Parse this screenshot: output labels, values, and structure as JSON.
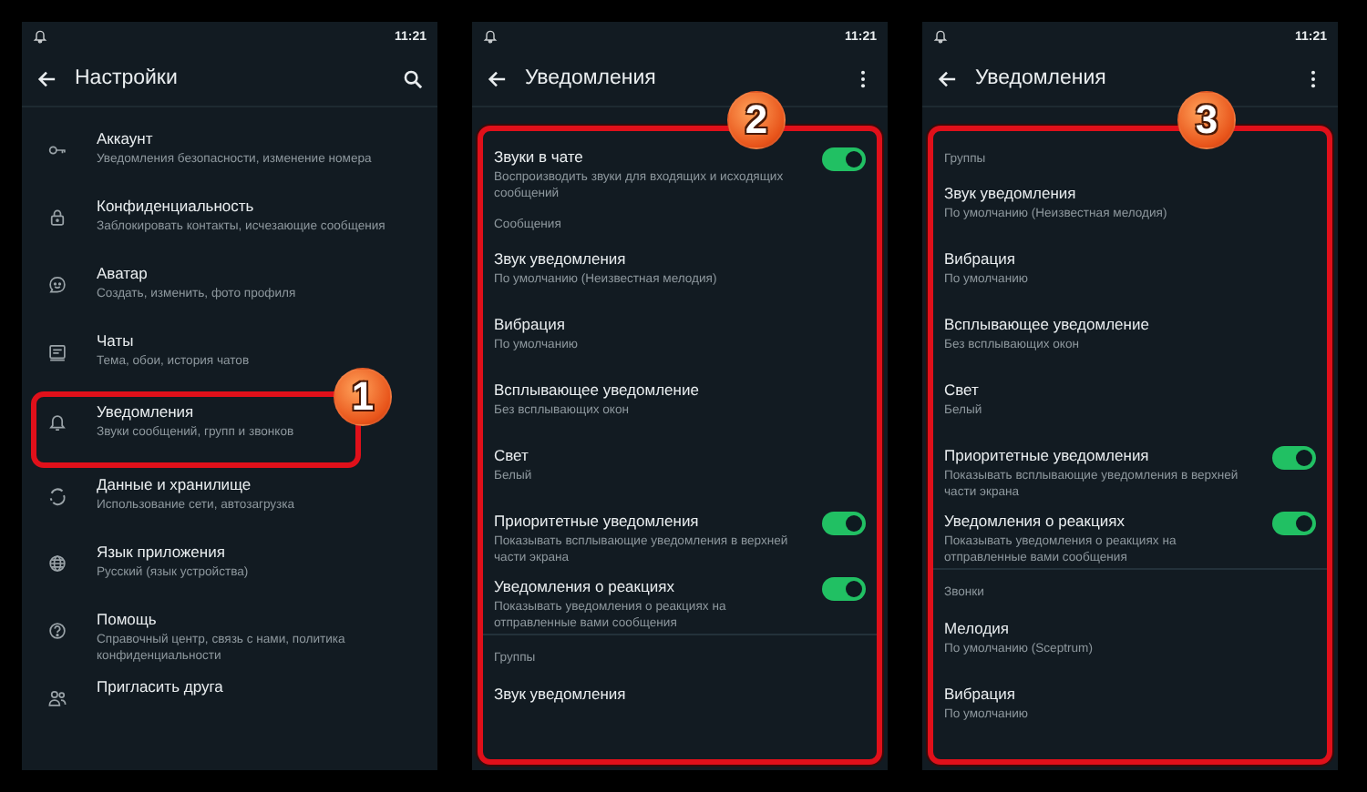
{
  "panels": [
    {
      "time": "11:21",
      "title": "Настройки",
      "framed": false,
      "badge": "1",
      "items": [
        {
          "kind": "setting",
          "title": "Аккаунт",
          "subtitle": "Уведомления безопасности, изменение номера",
          "highlighted": false
        },
        {
          "kind": "setting",
          "title": "Конфиденциальность",
          "subtitle": "Заблокировать контакты, исчезающие сообщения",
          "highlighted": false
        },
        {
          "kind": "setting",
          "title": "Аватар",
          "subtitle": "Создать, изменить, фото профиля",
          "highlighted": false
        },
        {
          "kind": "setting",
          "title": "Чаты",
          "subtitle": "Тема, обои, история чатов",
          "highlighted": false
        },
        {
          "kind": "setting",
          "title": "Уведомления",
          "subtitle": "Звуки сообщений, групп и звонков",
          "highlighted": true
        },
        {
          "kind": "setting",
          "title": "Данные и хранилище",
          "subtitle": "Использование сети, автозагрузка",
          "highlighted": false
        },
        {
          "kind": "setting",
          "title": "Язык приложения",
          "subtitle": "Русский (язык устройства)",
          "highlighted": false
        },
        {
          "kind": "setting",
          "title": "Помощь",
          "subtitle": "Справочный центр, связь с нами, политика конфиденциальности",
          "highlighted": false
        },
        {
          "kind": "setting",
          "title": "Пригласить друга",
          "highlighted": false
        }
      ]
    },
    {
      "time": "11:21",
      "title": "Уведомления",
      "framed": true,
      "badge": "2",
      "items": [
        {
          "kind": "toggle",
          "title": "Звуки в чате",
          "subtitle": "Воспроизводить звуки для входящих и исходящих сообщений",
          "on": true
        },
        {
          "kind": "section",
          "title": "Сообщения",
          "rule": false
        },
        {
          "kind": "pref",
          "title": "Звук уведомления",
          "subtitle": "По умолчанию (Неизвестная мелодия)"
        },
        {
          "kind": "pref",
          "title": "Вибрация",
          "subtitle": "По умолчанию"
        },
        {
          "kind": "pref",
          "title": "Всплывающее уведомление",
          "subtitle": "Без всплывающих окон"
        },
        {
          "kind": "pref",
          "title": "Свет",
          "subtitle": "Белый"
        },
        {
          "kind": "toggle",
          "title": "Приоритетные уведомления",
          "subtitle": "Показывать всплывающие уведомления в верхней части экрана",
          "on": true
        },
        {
          "kind": "toggle",
          "title": "Уведомления о реакциях",
          "subtitle": "Показывать уведомления о реакциях на отправленные вами сообщения",
          "on": true
        },
        {
          "kind": "section",
          "title": "Группы",
          "rule": true
        },
        {
          "kind": "pref",
          "title": "Звук уведомления"
        }
      ]
    },
    {
      "time": "11:21",
      "title": "Уведомления",
      "framed": true,
      "badge": "3",
      "items": [
        {
          "kind": "section",
          "title": "Группы",
          "rule": false
        },
        {
          "kind": "pref",
          "title": "Звук уведомления",
          "subtitle": "По умолчанию (Неизвестная мелодия)"
        },
        {
          "kind": "pref",
          "title": "Вибрация",
          "subtitle": "По умолчанию"
        },
        {
          "kind": "pref",
          "title": "Всплывающее уведомление",
          "subtitle": "Без всплывающих окон"
        },
        {
          "kind": "pref",
          "title": "Свет",
          "subtitle": "Белый"
        },
        {
          "kind": "toggle",
          "title": "Приоритетные уведомления",
          "subtitle": "Показывать всплывающие уведомления в верхней части экрана",
          "on": true
        },
        {
          "kind": "toggle",
          "title": "Уведомления о реакциях",
          "subtitle": "Показывать уведомления о реакциях на отправленные вами сообщения",
          "on": true
        },
        {
          "kind": "section",
          "title": "Звонки",
          "rule": true
        },
        {
          "kind": "pref",
          "title": "Мелодия",
          "subtitle": "По умолчанию (Sceptrum)"
        },
        {
          "kind": "pref",
          "title": "Вибрация",
          "subtitle": "По умолчанию"
        }
      ]
    }
  ]
}
